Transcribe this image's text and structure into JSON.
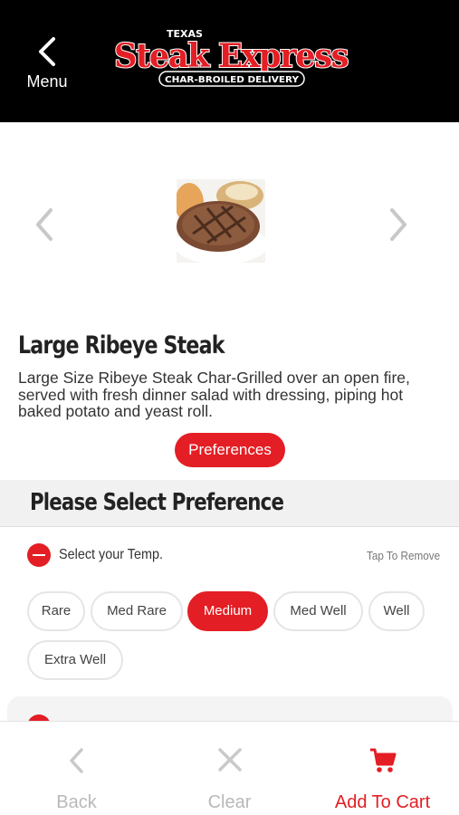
{
  "header": {
    "back_label": "Menu",
    "logo_top": "TEXAS",
    "logo_main": "Steak Express",
    "logo_sub": "CHAR-BROILED DELIVERY"
  },
  "product": {
    "title": "Large Ribeye Steak",
    "description": "Large Size Ribeye Steak Char-Grilled over an open fire, served with fresh dinner salad with dressing, piping hot baked potato and yeast roll.",
    "preferences_label": "Preferences"
  },
  "section": {
    "title": "Please Select Preference"
  },
  "temp_option": {
    "label": "Select your Temp.",
    "tap_remove": "Tap To Remove",
    "choices": [
      "Rare",
      "Med Rare",
      "Medium",
      "Med Well",
      "Well",
      "Extra Well"
    ],
    "selected": "Medium"
  },
  "bottom": {
    "back": "Back",
    "clear": "Clear",
    "add_to_cart": "Add To Cart"
  },
  "colors": {
    "accent": "#e31e24",
    "header_bg": "#000000",
    "disabled": "#b9b9b9"
  }
}
